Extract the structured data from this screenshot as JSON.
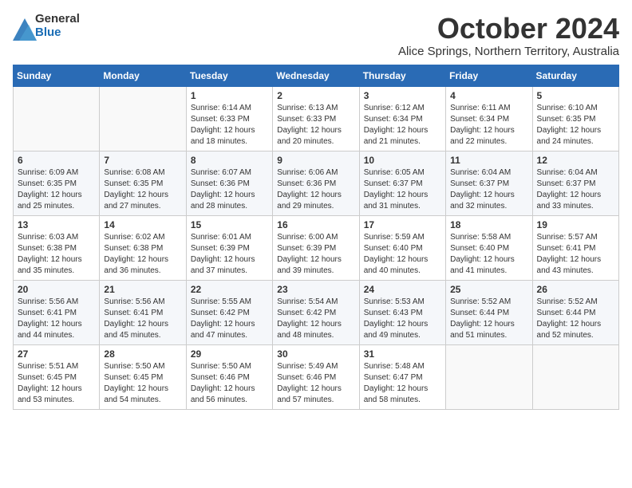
{
  "logo": {
    "general": "General",
    "blue": "Blue"
  },
  "title": "October 2024",
  "subtitle": "Alice Springs, Northern Territory, Australia",
  "days_header": [
    "Sunday",
    "Monday",
    "Tuesday",
    "Wednesday",
    "Thursday",
    "Friday",
    "Saturday"
  ],
  "weeks": [
    [
      {
        "day": "",
        "sunrise": "",
        "sunset": "",
        "daylight": ""
      },
      {
        "day": "",
        "sunrise": "",
        "sunset": "",
        "daylight": ""
      },
      {
        "day": "1",
        "sunrise": "Sunrise: 6:14 AM",
        "sunset": "Sunset: 6:33 PM",
        "daylight": "Daylight: 12 hours and 18 minutes."
      },
      {
        "day": "2",
        "sunrise": "Sunrise: 6:13 AM",
        "sunset": "Sunset: 6:33 PM",
        "daylight": "Daylight: 12 hours and 20 minutes."
      },
      {
        "day": "3",
        "sunrise": "Sunrise: 6:12 AM",
        "sunset": "Sunset: 6:34 PM",
        "daylight": "Daylight: 12 hours and 21 minutes."
      },
      {
        "day": "4",
        "sunrise": "Sunrise: 6:11 AM",
        "sunset": "Sunset: 6:34 PM",
        "daylight": "Daylight: 12 hours and 22 minutes."
      },
      {
        "day": "5",
        "sunrise": "Sunrise: 6:10 AM",
        "sunset": "Sunset: 6:35 PM",
        "daylight": "Daylight: 12 hours and 24 minutes."
      }
    ],
    [
      {
        "day": "6",
        "sunrise": "Sunrise: 6:09 AM",
        "sunset": "Sunset: 6:35 PM",
        "daylight": "Daylight: 12 hours and 25 minutes."
      },
      {
        "day": "7",
        "sunrise": "Sunrise: 6:08 AM",
        "sunset": "Sunset: 6:35 PM",
        "daylight": "Daylight: 12 hours and 27 minutes."
      },
      {
        "day": "8",
        "sunrise": "Sunrise: 6:07 AM",
        "sunset": "Sunset: 6:36 PM",
        "daylight": "Daylight: 12 hours and 28 minutes."
      },
      {
        "day": "9",
        "sunrise": "Sunrise: 6:06 AM",
        "sunset": "Sunset: 6:36 PM",
        "daylight": "Daylight: 12 hours and 29 minutes."
      },
      {
        "day": "10",
        "sunrise": "Sunrise: 6:05 AM",
        "sunset": "Sunset: 6:37 PM",
        "daylight": "Daylight: 12 hours and 31 minutes."
      },
      {
        "day": "11",
        "sunrise": "Sunrise: 6:04 AM",
        "sunset": "Sunset: 6:37 PM",
        "daylight": "Daylight: 12 hours and 32 minutes."
      },
      {
        "day": "12",
        "sunrise": "Sunrise: 6:04 AM",
        "sunset": "Sunset: 6:37 PM",
        "daylight": "Daylight: 12 hours and 33 minutes."
      }
    ],
    [
      {
        "day": "13",
        "sunrise": "Sunrise: 6:03 AM",
        "sunset": "Sunset: 6:38 PM",
        "daylight": "Daylight: 12 hours and 35 minutes."
      },
      {
        "day": "14",
        "sunrise": "Sunrise: 6:02 AM",
        "sunset": "Sunset: 6:38 PM",
        "daylight": "Daylight: 12 hours and 36 minutes."
      },
      {
        "day": "15",
        "sunrise": "Sunrise: 6:01 AM",
        "sunset": "Sunset: 6:39 PM",
        "daylight": "Daylight: 12 hours and 37 minutes."
      },
      {
        "day": "16",
        "sunrise": "Sunrise: 6:00 AM",
        "sunset": "Sunset: 6:39 PM",
        "daylight": "Daylight: 12 hours and 39 minutes."
      },
      {
        "day": "17",
        "sunrise": "Sunrise: 5:59 AM",
        "sunset": "Sunset: 6:40 PM",
        "daylight": "Daylight: 12 hours and 40 minutes."
      },
      {
        "day": "18",
        "sunrise": "Sunrise: 5:58 AM",
        "sunset": "Sunset: 6:40 PM",
        "daylight": "Daylight: 12 hours and 41 minutes."
      },
      {
        "day": "19",
        "sunrise": "Sunrise: 5:57 AM",
        "sunset": "Sunset: 6:41 PM",
        "daylight": "Daylight: 12 hours and 43 minutes."
      }
    ],
    [
      {
        "day": "20",
        "sunrise": "Sunrise: 5:56 AM",
        "sunset": "Sunset: 6:41 PM",
        "daylight": "Daylight: 12 hours and 44 minutes."
      },
      {
        "day": "21",
        "sunrise": "Sunrise: 5:56 AM",
        "sunset": "Sunset: 6:41 PM",
        "daylight": "Daylight: 12 hours and 45 minutes."
      },
      {
        "day": "22",
        "sunrise": "Sunrise: 5:55 AM",
        "sunset": "Sunset: 6:42 PM",
        "daylight": "Daylight: 12 hours and 47 minutes."
      },
      {
        "day": "23",
        "sunrise": "Sunrise: 5:54 AM",
        "sunset": "Sunset: 6:42 PM",
        "daylight": "Daylight: 12 hours and 48 minutes."
      },
      {
        "day": "24",
        "sunrise": "Sunrise: 5:53 AM",
        "sunset": "Sunset: 6:43 PM",
        "daylight": "Daylight: 12 hours and 49 minutes."
      },
      {
        "day": "25",
        "sunrise": "Sunrise: 5:52 AM",
        "sunset": "Sunset: 6:44 PM",
        "daylight": "Daylight: 12 hours and 51 minutes."
      },
      {
        "day": "26",
        "sunrise": "Sunrise: 5:52 AM",
        "sunset": "Sunset: 6:44 PM",
        "daylight": "Daylight: 12 hours and 52 minutes."
      }
    ],
    [
      {
        "day": "27",
        "sunrise": "Sunrise: 5:51 AM",
        "sunset": "Sunset: 6:45 PM",
        "daylight": "Daylight: 12 hours and 53 minutes."
      },
      {
        "day": "28",
        "sunrise": "Sunrise: 5:50 AM",
        "sunset": "Sunset: 6:45 PM",
        "daylight": "Daylight: 12 hours and 54 minutes."
      },
      {
        "day": "29",
        "sunrise": "Sunrise: 5:50 AM",
        "sunset": "Sunset: 6:46 PM",
        "daylight": "Daylight: 12 hours and 56 minutes."
      },
      {
        "day": "30",
        "sunrise": "Sunrise: 5:49 AM",
        "sunset": "Sunset: 6:46 PM",
        "daylight": "Daylight: 12 hours and 57 minutes."
      },
      {
        "day": "31",
        "sunrise": "Sunrise: 5:48 AM",
        "sunset": "Sunset: 6:47 PM",
        "daylight": "Daylight: 12 hours and 58 minutes."
      },
      {
        "day": "",
        "sunrise": "",
        "sunset": "",
        "daylight": ""
      },
      {
        "day": "",
        "sunrise": "",
        "sunset": "",
        "daylight": ""
      }
    ]
  ]
}
